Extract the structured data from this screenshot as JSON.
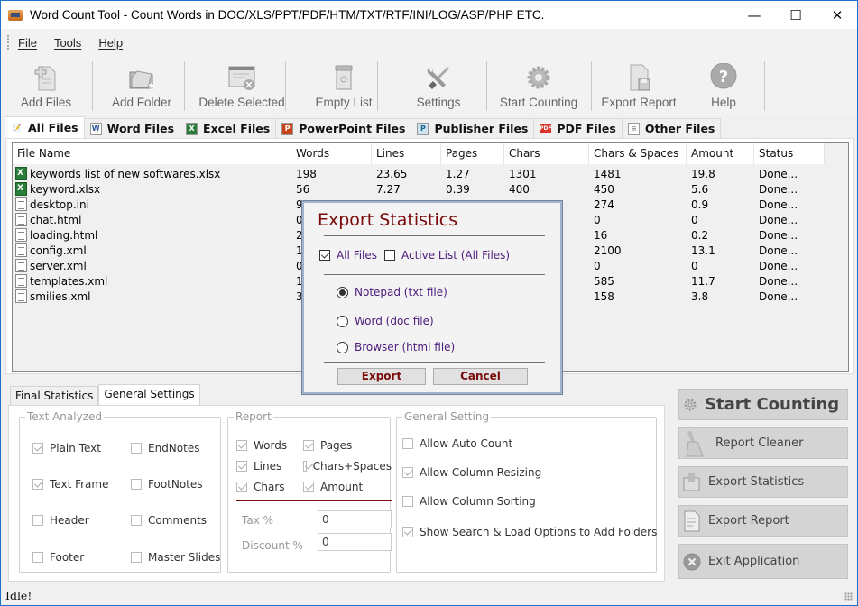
{
  "window": {
    "title": "Word Count Tool - Count Words in DOC/XLS/PPT/PDF/HTM/TXT/RTF/INI/LOG/ASP/PHP ETC.",
    "minimize": "—",
    "maximize": "☐",
    "close": "✕"
  },
  "menu": {
    "file": "File",
    "tools": "Tools",
    "help": "Help"
  },
  "toolbar": {
    "add_files": "Add Files",
    "add_folder": "Add Folder",
    "delete_selected": "Delete Selected",
    "empty_list": "Empty List",
    "settings": "Settings",
    "start_counting": "Start Counting",
    "export_report": "Export Report",
    "help": "Help"
  },
  "tabs": [
    {
      "label": "All Files",
      "icon": "all-files-icon"
    },
    {
      "label": "Word Files",
      "icon": "word-icon"
    },
    {
      "label": "Excel Files",
      "icon": "excel-icon"
    },
    {
      "label": "PowerPoint Files",
      "icon": "powerpoint-icon"
    },
    {
      "label": "Publisher Files",
      "icon": "publisher-icon"
    },
    {
      "label": "PDF Files",
      "icon": "pdf-icon"
    },
    {
      "label": "Other Files",
      "icon": "document-icon"
    }
  ],
  "table": {
    "columns": [
      "File Name",
      "Words",
      "Lines",
      "Pages",
      "Chars",
      "Chars & Spaces",
      "Amount",
      "Status"
    ],
    "rows": [
      {
        "type": "xlsx",
        "name": "keywords list of new softwares.xlsx",
        "words": "198",
        "lines": "23.65",
        "pages": "1.27",
        "chars": "1301",
        "chars_spaces": "1481",
        "amount": "19.8",
        "status": "Done..."
      },
      {
        "type": "xlsx",
        "name": "keyword.xlsx",
        "words": "56",
        "lines": "7.27",
        "pages": "0.39",
        "chars": "400",
        "chars_spaces": "450",
        "amount": "5.6",
        "status": "Done..."
      },
      {
        "type": "text",
        "name": "desktop.ini",
        "words": "9",
        "lines": "",
        "pages": "",
        "chars": "",
        "chars_spaces": "274",
        "amount": "0.9",
        "status": "Done..."
      },
      {
        "type": "text",
        "name": "chat.html",
        "words": "0",
        "lines": "",
        "pages": "",
        "chars": "",
        "chars_spaces": "0",
        "amount": "0",
        "status": "Done..."
      },
      {
        "type": "text",
        "name": "loading.html",
        "words": "2",
        "lines": "",
        "pages": "",
        "chars": "",
        "chars_spaces": "16",
        "amount": "0.2",
        "status": "Done..."
      },
      {
        "type": "text",
        "name": "config.xml",
        "words": "1",
        "lines": "",
        "pages": "",
        "chars": "",
        "chars_spaces": "2100",
        "amount": "13.1",
        "status": "Done..."
      },
      {
        "type": "text",
        "name": "server.xml",
        "words": "0",
        "lines": "",
        "pages": "",
        "chars": "",
        "chars_spaces": "0",
        "amount": "0",
        "status": "Done..."
      },
      {
        "type": "text",
        "name": "templates.xml",
        "words": "1",
        "lines": "",
        "pages": "",
        "chars": "",
        "chars_spaces": "585",
        "amount": "11.7",
        "status": "Done..."
      },
      {
        "type": "text",
        "name": "smilies.xml",
        "words": "3",
        "lines": "",
        "pages": "",
        "chars": "",
        "chars_spaces": "158",
        "amount": "3.8",
        "status": "Done..."
      }
    ]
  },
  "bottom_tabs": {
    "final_statistics": "Final Statistics",
    "general_settings": "General Settings"
  },
  "text_analyzed": {
    "legend": "Text Analyzed",
    "items": [
      {
        "label": "Plain Text",
        "checked": true
      },
      {
        "label": "EndNotes",
        "checked": false
      },
      {
        "label": "Text Frame",
        "checked": true
      },
      {
        "label": "FootNotes",
        "checked": false
      },
      {
        "label": "Header",
        "checked": false
      },
      {
        "label": "Comments",
        "checked": false
      },
      {
        "label": "Footer",
        "checked": false
      },
      {
        "label": "Master Slides",
        "checked": false
      }
    ]
  },
  "report": {
    "legend": "Report",
    "items": [
      {
        "label": "Words",
        "checked": true
      },
      {
        "label": "Pages",
        "checked": true
      },
      {
        "label": "Lines",
        "checked": true
      },
      {
        "label": "Chars+Spaces",
        "checked": true
      },
      {
        "label": "Chars",
        "checked": true
      },
      {
        "label": "Amount",
        "checked": true
      }
    ],
    "tax_label": "Tax %",
    "tax_value": "0",
    "discount_label": "Discount %",
    "discount_value": "0"
  },
  "general_setting": {
    "legend": "General Setting",
    "items": [
      {
        "label": "Allow Auto Count",
        "checked": false
      },
      {
        "label": "Allow Column Resizing",
        "checked": true
      },
      {
        "label": "Allow Column Sorting",
        "checked": false
      },
      {
        "label": "Show Search & Load Options to Add Folders",
        "checked": true
      }
    ]
  },
  "side_buttons": {
    "start_counting": "Start Counting",
    "report_cleaner": "Report Cleaner",
    "export_statistics": "Export Statistics",
    "export_report": "Export Report",
    "exit_application": "Exit Application"
  },
  "status": "Idle!",
  "dialog": {
    "title": "Export Statistics",
    "all_files": {
      "label": "All Files",
      "checked": true
    },
    "active_list": {
      "label": "Active List (All Files)",
      "checked": false
    },
    "options": [
      {
        "label": "Notepad (txt file)",
        "selected": true
      },
      {
        "label": "Word (doc file)",
        "selected": false
      },
      {
        "label": "Browser (html file)",
        "selected": false
      }
    ],
    "export": "Export",
    "cancel": "Cancel"
  }
}
